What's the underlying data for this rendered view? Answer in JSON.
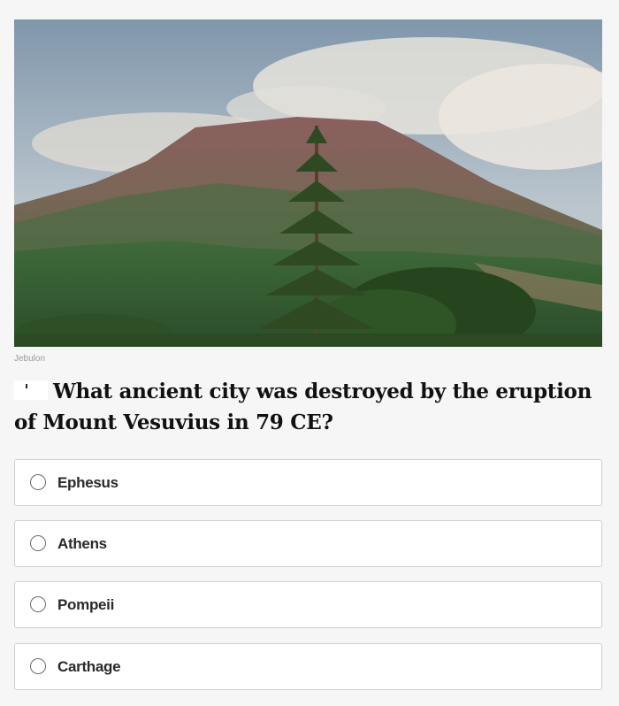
{
  "photo": {
    "icon": "volcano-landscape-photo"
  },
  "credit": "Jebulon",
  "question": {
    "text": "What ancient city was destroyed by the eruption of Mount Vesuvius in 79 CE?"
  },
  "options": [
    {
      "label": "Ephesus"
    },
    {
      "label": "Athens"
    },
    {
      "label": "Pompeii"
    },
    {
      "label": "Carthage"
    }
  ],
  "colors": {
    "background": "#f6f6f6",
    "option_border": "#cfcfcf",
    "question_text": "#111111"
  }
}
